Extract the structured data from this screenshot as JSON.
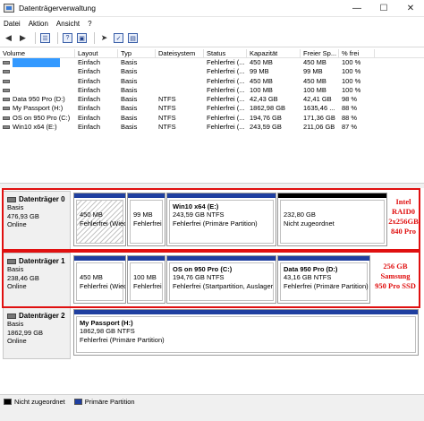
{
  "window": {
    "title": "Datenträgerverwaltung",
    "controls": [
      "—",
      "☐",
      "✕"
    ]
  },
  "menu": [
    "Datei",
    "Aktion",
    "Ansicht",
    "?"
  ],
  "volume_list": {
    "columns": [
      "Volume",
      "Layout",
      "Typ",
      "Dateisystem",
      "Status",
      "Kapazität",
      "Freier Sp...",
      "% frei"
    ],
    "rows": [
      {
        "volume": "",
        "layout": "Einfach",
        "typ": "Basis",
        "fs": "",
        "status": "Fehlerfrei (...",
        "kap": "450 MB",
        "frei": "450 MB",
        "pct": "100 %",
        "selected": true
      },
      {
        "volume": "",
        "layout": "Einfach",
        "typ": "Basis",
        "fs": "",
        "status": "Fehlerfrei (...",
        "kap": "99 MB",
        "frei": "99 MB",
        "pct": "100 %"
      },
      {
        "volume": "",
        "layout": "Einfach",
        "typ": "Basis",
        "fs": "",
        "status": "Fehlerfrei (...",
        "kap": "450 MB",
        "frei": "450 MB",
        "pct": "100 %"
      },
      {
        "volume": "",
        "layout": "Einfach",
        "typ": "Basis",
        "fs": "",
        "status": "Fehlerfrei (...",
        "kap": "100 MB",
        "frei": "100 MB",
        "pct": "100 %"
      },
      {
        "volume": "Data 950 Pro (D:)",
        "layout": "Einfach",
        "typ": "Basis",
        "fs": "NTFS",
        "status": "Fehlerfrei (...",
        "kap": "42,43 GB",
        "frei": "42,41 GB",
        "pct": "98 %"
      },
      {
        "volume": "My Passport (H:)",
        "layout": "Einfach",
        "typ": "Basis",
        "fs": "NTFS",
        "status": "Fehlerfrei (...",
        "kap": "1862,98 GB",
        "frei": "1635,46 ...",
        "pct": "88 %"
      },
      {
        "volume": "OS on 950 Pro (C:)",
        "layout": "Einfach",
        "typ": "Basis",
        "fs": "NTFS",
        "status": "Fehlerfrei (...",
        "kap": "194,76 GB",
        "frei": "171,36 GB",
        "pct": "88 %"
      },
      {
        "volume": "Win10 x64 (E:)",
        "layout": "Einfach",
        "typ": "Basis",
        "fs": "NTFS",
        "status": "Fehlerfrei (...",
        "kap": "243,59 GB",
        "frei": "211,06 GB",
        "pct": "87 %"
      }
    ]
  },
  "disks": [
    {
      "name": "Datenträger 0",
      "type": "Basis",
      "size": "476,93 GB",
      "state": "Online",
      "partitions": [
        {
          "title": "",
          "size": "450 MB",
          "status": "Fehlerfrei (Wiec",
          "hatched": true
        },
        {
          "title": "",
          "size": "99 MB",
          "status": "Fehlerfrei"
        },
        {
          "title": "Win10 x64  (E:)",
          "size": "243,59 GB NTFS",
          "status": "Fehlerfrei (Primäre Partition)"
        },
        {
          "title": "",
          "size": "232,80 GB",
          "status": "Nicht zugeordnet",
          "unallocated": true
        }
      ],
      "note": [
        "Intel",
        "RAID0",
        "2x256GB",
        "840 Pro"
      ]
    },
    {
      "name": "Datenträger 1",
      "type": "Basis",
      "size": "238,46 GB",
      "state": "Online",
      "partitions": [
        {
          "title": "",
          "size": "450 MB",
          "status": "Fehlerfrei (Wiec"
        },
        {
          "title": "",
          "size": "100 MB",
          "status": "Fehlerfrei"
        },
        {
          "title": "OS on 950 Pro  (C:)",
          "size": "194,76 GB NTFS",
          "status": "Fehlerfrei (Startpartition, Auslager"
        },
        {
          "title": "Data 950 Pro  (D:)",
          "size": "43,16 GB NTFS",
          "status": "Fehlerfrei (Primäre Partition)"
        }
      ],
      "note": [
        "256 GB",
        "Samsung",
        "950 Pro SSD"
      ]
    },
    {
      "name": "Datenträger 2",
      "type": "Basis",
      "size": "1862,99 GB",
      "state": "Online",
      "partitions": [
        {
          "title": "My Passport  (H:)",
          "size": "1862,98 GB NTFS",
          "status": "Fehlerfrei (Primäre Partition)"
        }
      ]
    }
  ],
  "legend": [
    {
      "label": "Nicht zugeordnet",
      "color": "#000000"
    },
    {
      "label": "Primäre Partition",
      "color": "#1f3fa0"
    }
  ],
  "colors": {
    "primary": "#1f3fa0",
    "unallocated": "#000000",
    "annotation": "#e01010",
    "selection": "#3399ff"
  }
}
